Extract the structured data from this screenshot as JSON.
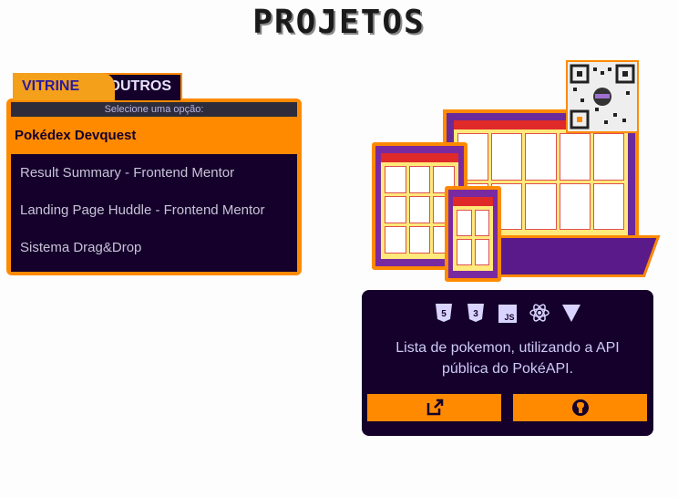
{
  "page": {
    "title": "PROJETOS"
  },
  "tabs": [
    {
      "label": "VITRINE",
      "active": true
    },
    {
      "label": "OUTROS",
      "active": false
    }
  ],
  "select": {
    "hint": "Selecione uma opção:",
    "options": [
      {
        "label": "Pokédex Devquest",
        "selected": true
      },
      {
        "label": "Result Summary - Frontend Mentor",
        "selected": false
      },
      {
        "label": "Landing Page Huddle - Frontend Mentor",
        "selected": false
      },
      {
        "label": "Sistema Drag&Drop",
        "selected": false
      }
    ]
  },
  "project": {
    "tech_icons": [
      "html5-icon",
      "css3-icon",
      "js-icon",
      "react-icon",
      "vite-icon"
    ],
    "description": "Lista de pokemon, utilizando a API pública do PokéAPI.",
    "buttons": {
      "external": "external-link-icon",
      "github": "github-icon"
    }
  },
  "colors": {
    "accent": "#ff8a00",
    "panel": "#14002b",
    "tab_active": "#f4a01a",
    "text_light": "#cfcaf7"
  }
}
